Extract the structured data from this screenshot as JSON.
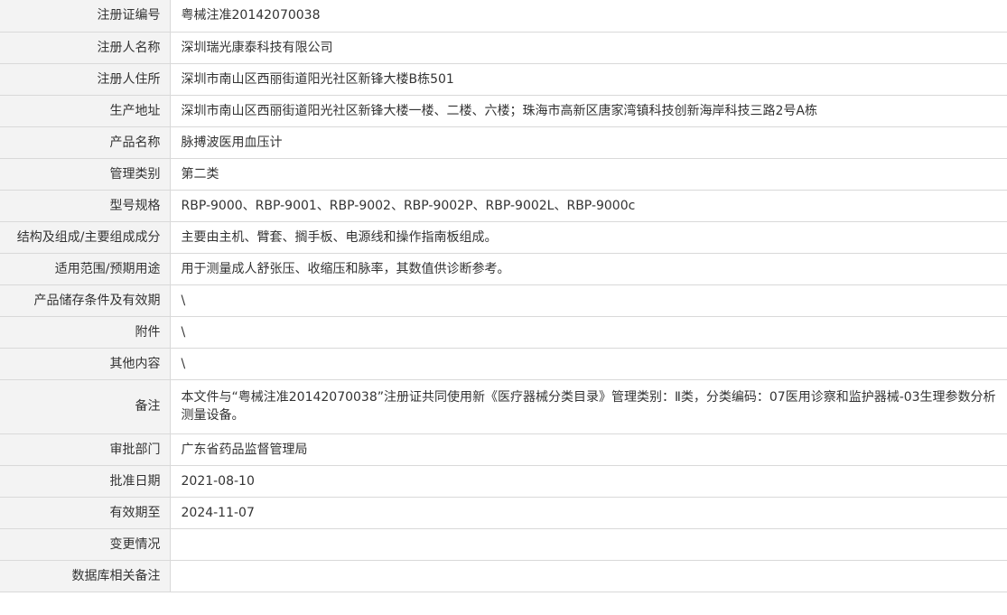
{
  "rows": [
    {
      "label": "注册证编号",
      "value": "粤械注准20142070038"
    },
    {
      "label": "注册人名称",
      "value": "深圳瑞光康泰科技有限公司"
    },
    {
      "label": "注册人住所",
      "value": "深圳市南山区西丽街道阳光社区新锋大楼B栋501"
    },
    {
      "label": "生产地址",
      "value": "深圳市南山区西丽街道阳光社区新锋大楼一楼、二楼、六楼；珠海市高新区唐家湾镇科技创新海岸科技三路2号A栋"
    },
    {
      "label": "产品名称",
      "value": "脉搏波医用血压计"
    },
    {
      "label": "管理类别",
      "value": "第二类"
    },
    {
      "label": "型号规格",
      "value": "RBP-9000、RBP-9001、RBP-9002、RBP-9002P、RBP-9002L、RBP-9000c"
    },
    {
      "label": "结构及组成/主要组成成分",
      "value": "主要由主机、臂套、搁手板、电源线和操作指南板组成。"
    },
    {
      "label": "适用范围/预期用途",
      "value": "用于测量成人舒张压、收缩压和脉率，其数值供诊断参考。"
    },
    {
      "label": "产品储存条件及有效期",
      "value": "\\"
    },
    {
      "label": "附件",
      "value": "\\"
    },
    {
      "label": "其他内容",
      "value": "\\"
    },
    {
      "label": "备注",
      "value": "本文件与“粤械注准20142070038”注册证共同使用新《医疗器械分类目录》管理类别：Ⅱ类，分类编码：07医用诊察和监护器械-03生理参数分析测量设备。"
    },
    {
      "label": "审批部门",
      "value": "广东省药品监督管理局"
    },
    {
      "label": "批准日期",
      "value": "2021-08-10"
    },
    {
      "label": "有效期至",
      "value": "2024-11-07"
    },
    {
      "label": "变更情况",
      "value": ""
    },
    {
      "label": "数据库相关备注",
      "value": ""
    }
  ]
}
